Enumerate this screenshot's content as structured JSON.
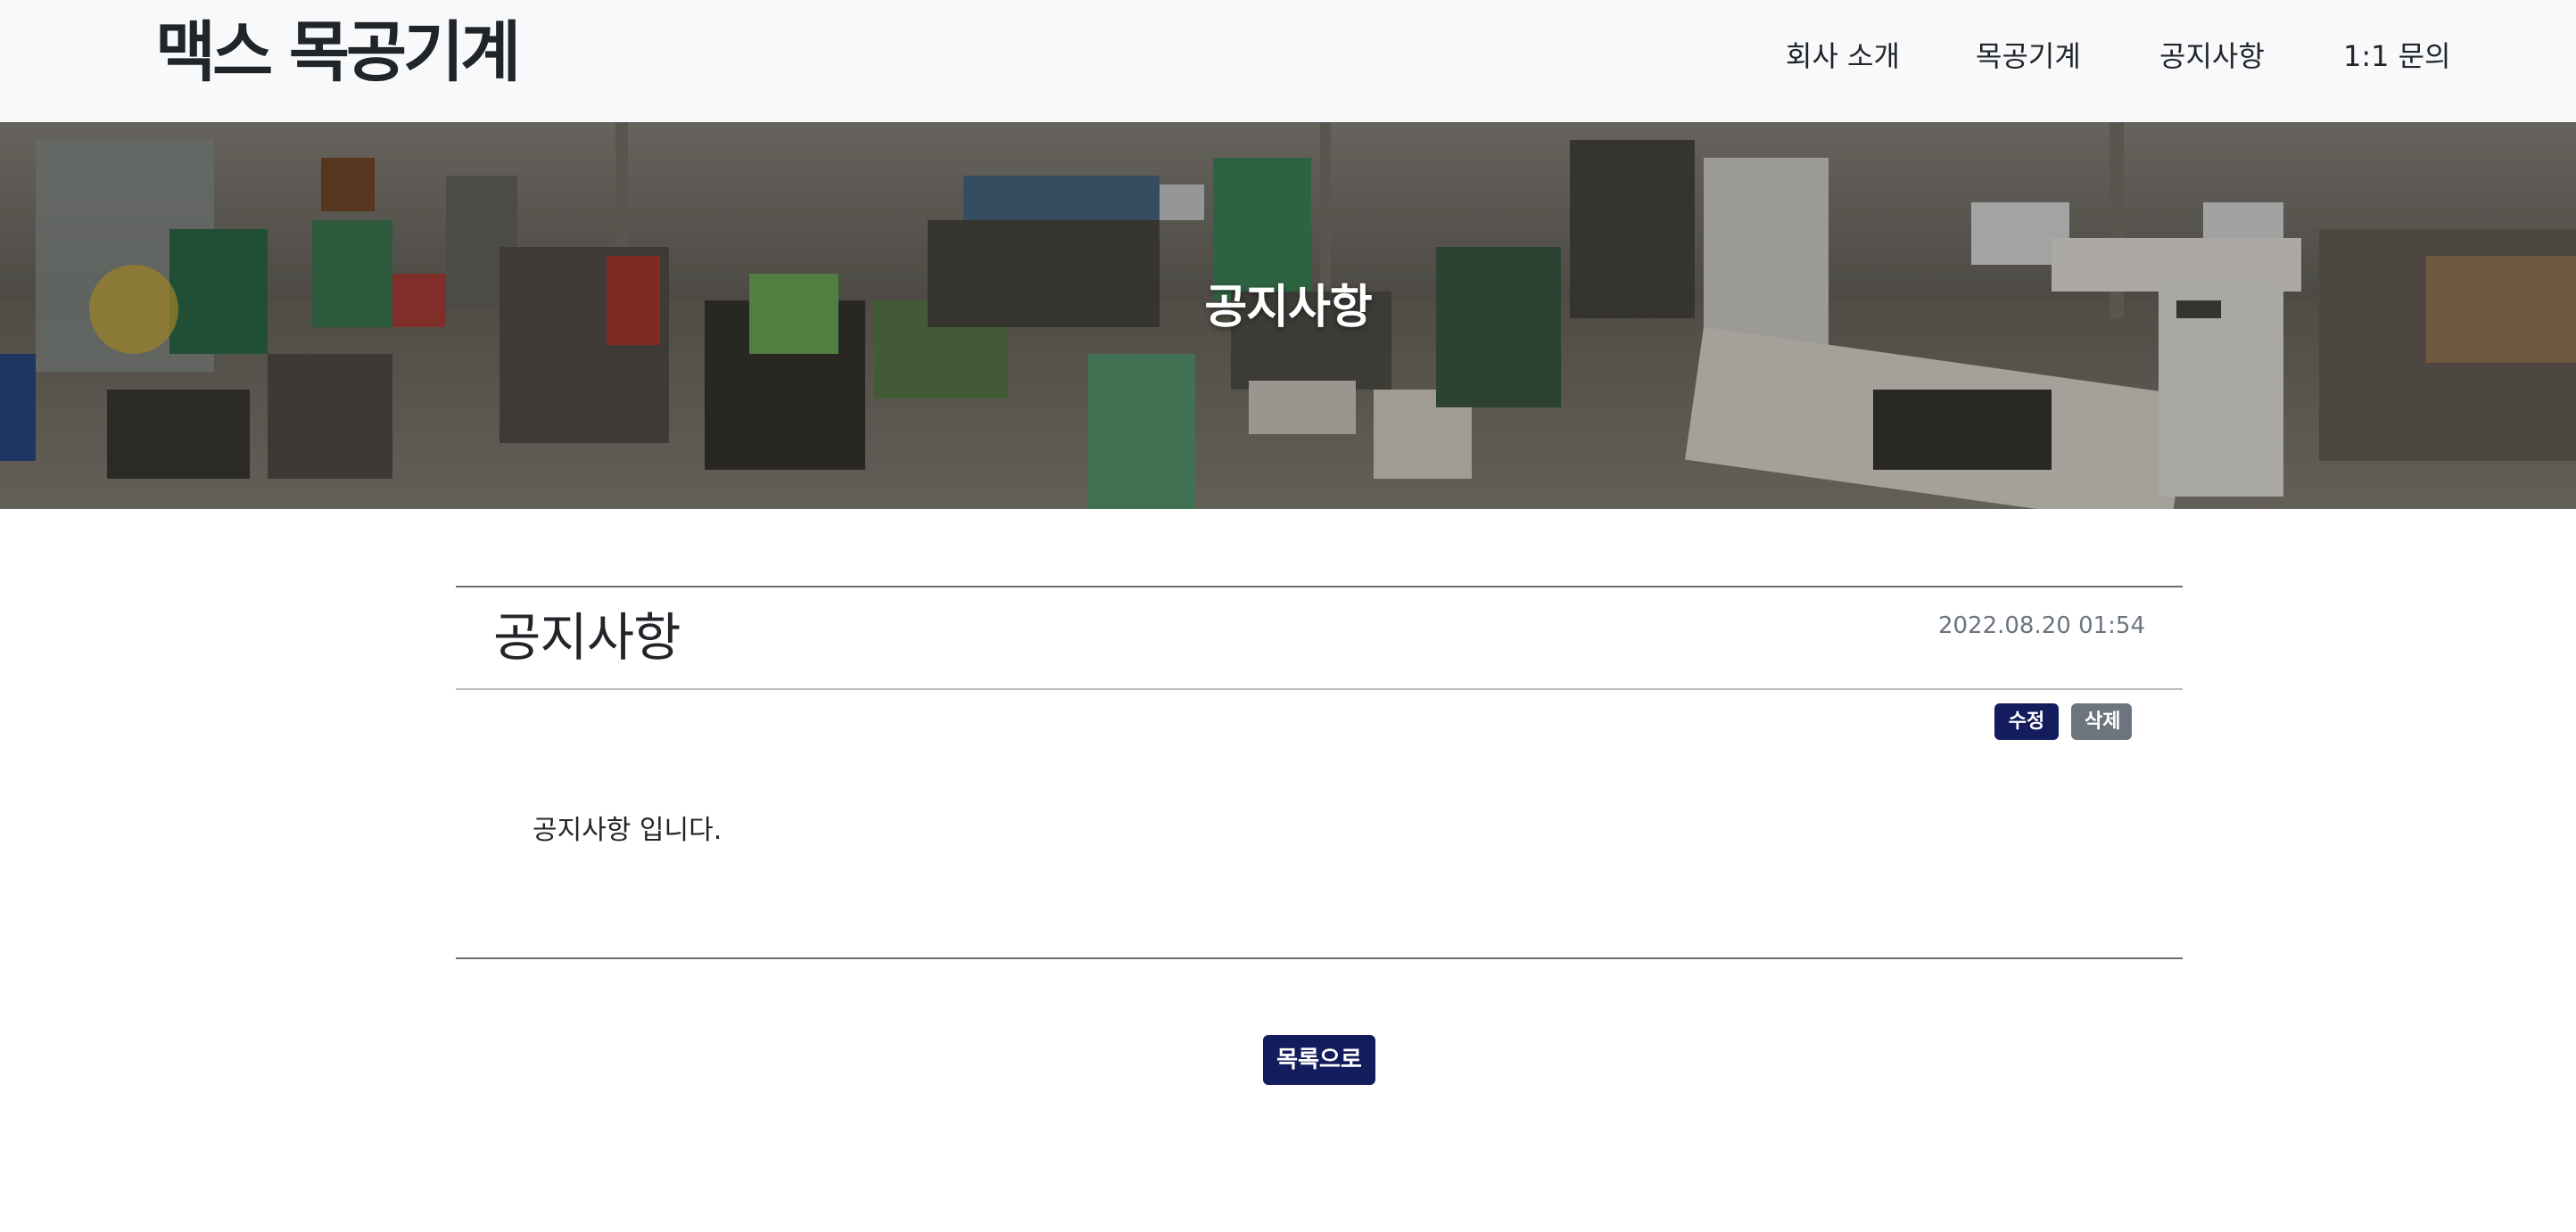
{
  "header": {
    "logo": "맥스 목공기계",
    "nav": [
      "회사 소개",
      "목공기계",
      "공지사항",
      "1:1 문의"
    ]
  },
  "hero": {
    "title": "공지사항"
  },
  "post": {
    "title": "공지사항",
    "date": "2022.08.20 01:54",
    "edit_label": "수정",
    "delete_label": "삭제",
    "body": "공지사항 입니다."
  },
  "footer_actions": {
    "list_label": "목록으로"
  },
  "colors": {
    "header_bg": "#f8f9fa",
    "primary_button": "#131c5c",
    "secondary_button": "#6c757d"
  }
}
